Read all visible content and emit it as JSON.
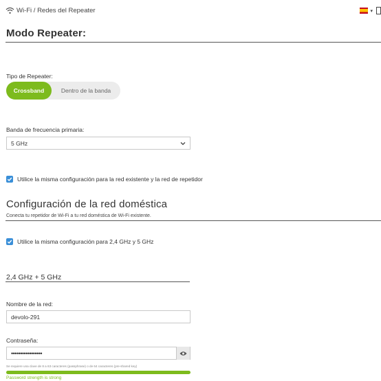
{
  "breadcrumb": {
    "icon": "wifi-icon",
    "text": "Wi-Fi / Redes del Repeater"
  },
  "language": {
    "icon": "spain-flag-icon",
    "caret": "▾"
  },
  "repeater_mode": {
    "title": "Modo Repeater:",
    "type_label": "Tipo de Repeater:",
    "options": [
      "Crossband",
      "Dentro de la banda"
    ],
    "selected": "Crossband"
  },
  "frequency": {
    "label": "Banda de frecuencia primaria:",
    "value": "5 GHz",
    "icon": "chevron-down-icon"
  },
  "same_config_networks": {
    "checked": true,
    "label": "Utilice la misma configuración para la red existente y la red de repetidor"
  },
  "home_network": {
    "title": "Configuración de la red doméstica",
    "subtitle": "Conecta tu repetidor de Wi-Fi a tu red doméstica de Wi-Fi existente."
  },
  "same_config_bands": {
    "checked": true,
    "label": "Utilice la misma configuración para 2,4 GHz y 5 GHz"
  },
  "band_section": {
    "title": "2,4 GHz + 5 GHz"
  },
  "network_name": {
    "label": "Nombre de la red:",
    "value": "devolo-291"
  },
  "password": {
    "label": "Contraseña:",
    "masked_value": "•••••••••••••••••",
    "hint": "Se requiere una clave de 8 a 63 caracteres (passphrase) o de 64 caracteres (pre-shared key)",
    "strength_text": "Password strength is strong",
    "strength_fraction": 1.0
  },
  "colors": {
    "accent": "#7dbb1d",
    "checkbox": "#3a8fd8"
  }
}
